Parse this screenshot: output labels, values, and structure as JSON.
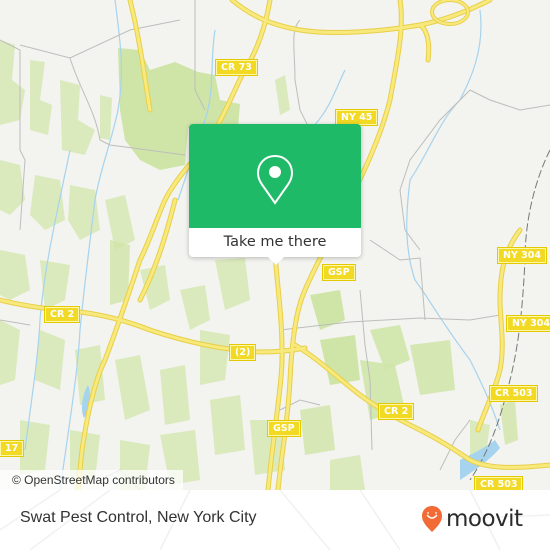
{
  "map": {
    "road_labels": [
      {
        "id": "cr73",
        "text": "CR 73"
      },
      {
        "id": "ny45",
        "text": "NY 45"
      },
      {
        "id": "gsp1",
        "text": "GSP"
      },
      {
        "id": "ny304a",
        "text": "NY 304"
      },
      {
        "id": "cr2a",
        "text": "CR 2"
      },
      {
        "id": "ny304b",
        "text": "NY 304"
      },
      {
        "id": "route2",
        "text": "(2)"
      },
      {
        "id": "cr503a",
        "text": "CR 503"
      },
      {
        "id": "cr2b",
        "text": "CR 2"
      },
      {
        "id": "gsp2",
        "text": "GSP"
      },
      {
        "id": "r17",
        "text": "17"
      },
      {
        "id": "cr503b",
        "text": "CR 503"
      }
    ],
    "colors": {
      "background": "#f3f3ef",
      "park": "#cfe5a8",
      "road_major": "#f6e16c",
      "road_minor": "#bdbdbd",
      "water": "#a6d3ee",
      "shield": "#f2d923"
    }
  },
  "popup": {
    "action_label": "Take me there",
    "icon": "location-pin-icon",
    "color": "#1fba67"
  },
  "attribution": {
    "text": "© OpenStreetMap contributors"
  },
  "footer": {
    "place_name": "Swat Pest Control, New York City",
    "brand": "moovit",
    "brand_icon": "moovit-smile-pin-icon",
    "brand_color": "#f26a35"
  }
}
